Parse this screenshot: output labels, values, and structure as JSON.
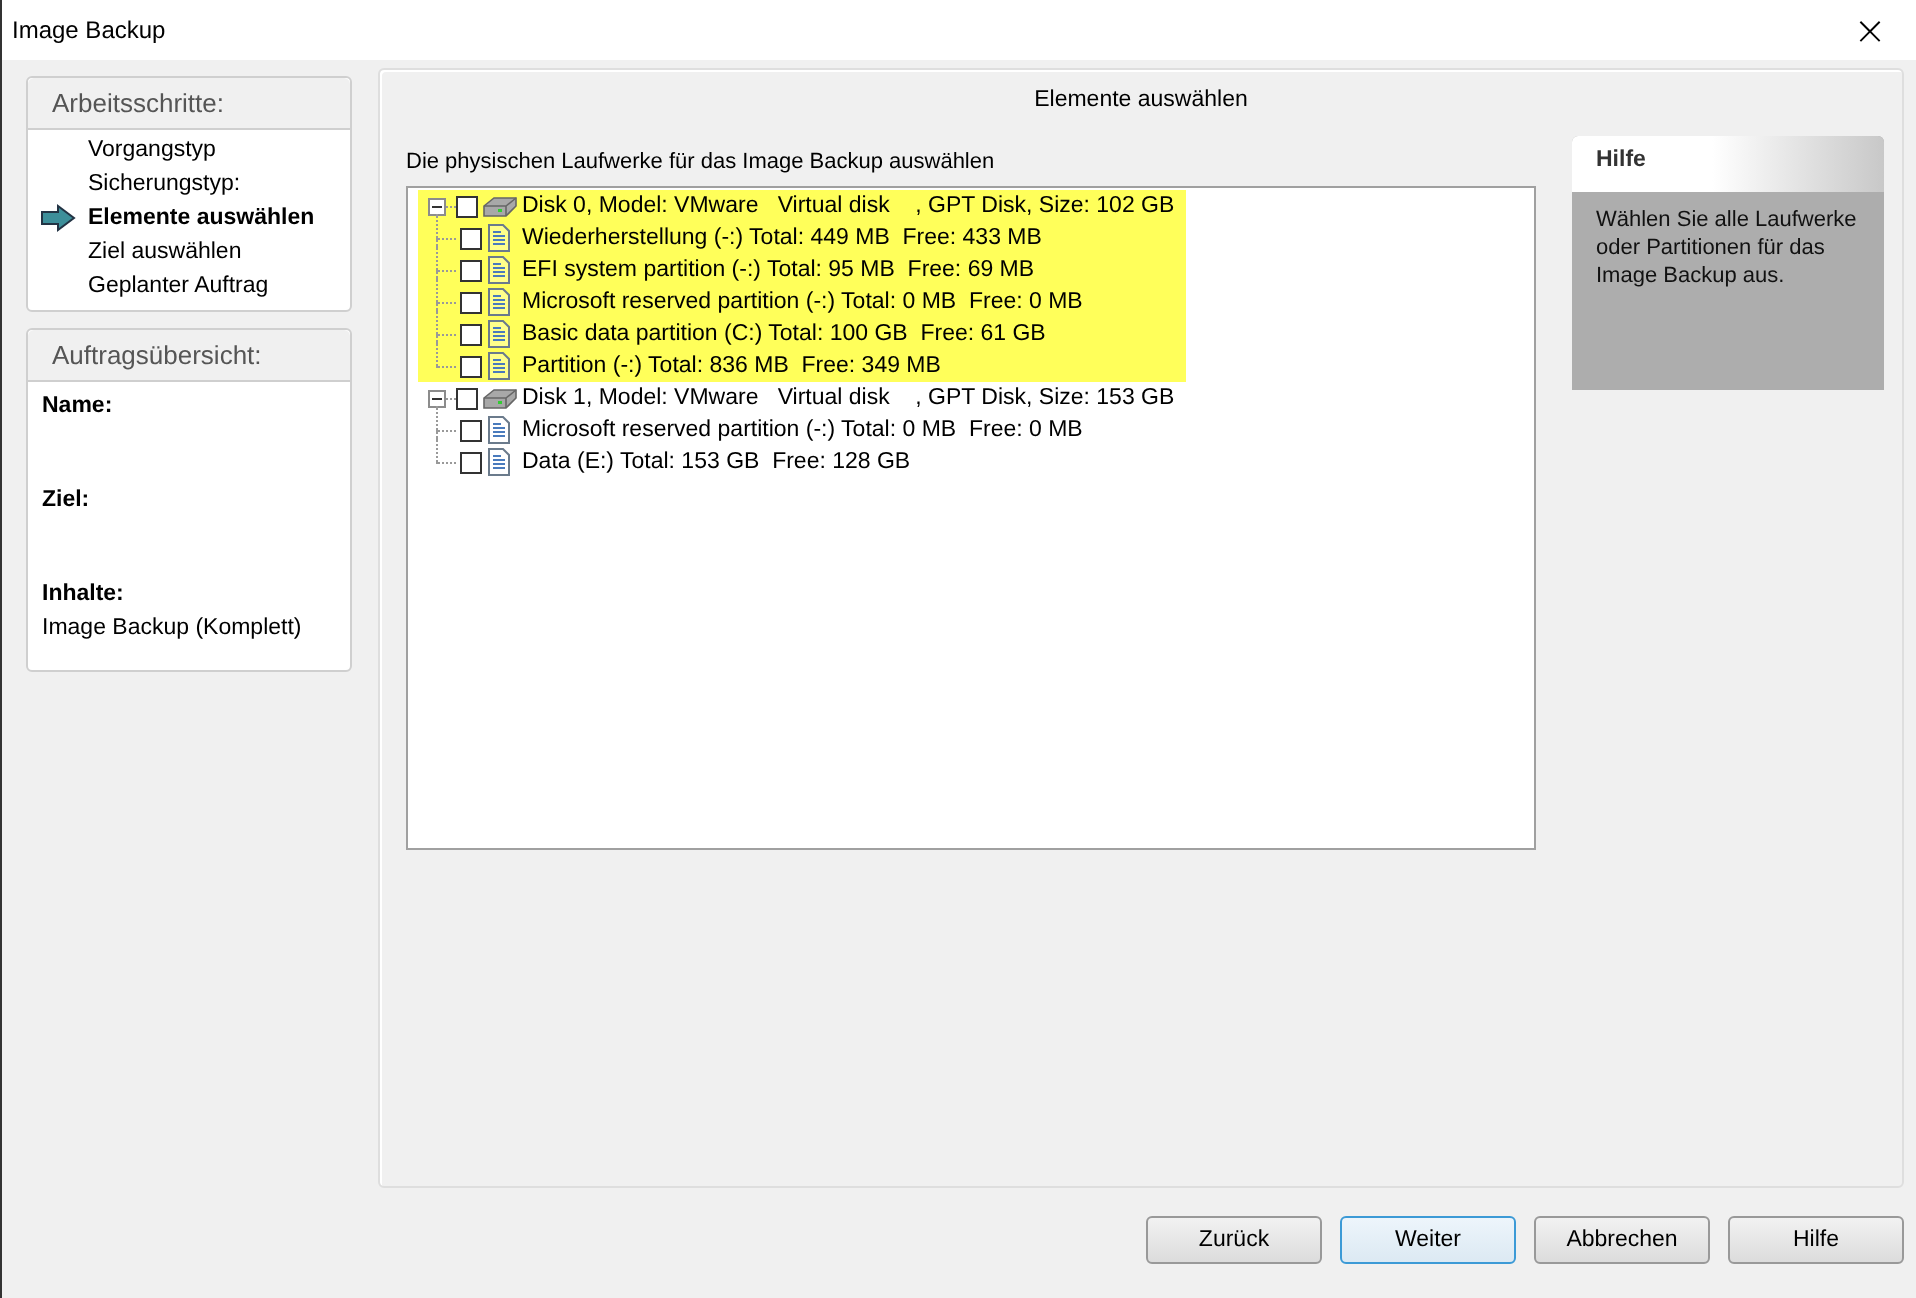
{
  "window": {
    "title": "Image Backup",
    "close": "×"
  },
  "steps": {
    "title": "Arbeitsschritte:",
    "items": [
      {
        "label": "Vorgangstyp",
        "selected": false
      },
      {
        "label": "Sicherungstyp:",
        "selected": false
      },
      {
        "label": "Elemente auswählen",
        "selected": true
      },
      {
        "label": "Ziel auswählen",
        "selected": false
      },
      {
        "label": "Geplanter Auftrag",
        "selected": false
      }
    ]
  },
  "summary": {
    "title": "Auftragsübersicht:",
    "fields": [
      {
        "label": "Name:"
      },
      {
        "label": "Ziel:"
      },
      {
        "label": "Inhalte:",
        "value": "Image Backup (Komplett)"
      }
    ]
  },
  "main": {
    "heading": "Elemente auswählen",
    "subtitle": "Die physischen Laufwerke für das Image Backup auswählen",
    "disks": [
      {
        "label": "Disk 0, Model: VMware   Virtual disk    , GPT Disk, Size: 102 GB",
        "checked": false,
        "expanded": true,
        "highlighted": true,
        "children": [
          {
            "label": "Wiederherstellung (-:) Total: 449 MB  Free: 433 MB",
            "checked": false
          },
          {
            "label": "EFI system partition (-:) Total: 95 MB  Free: 69 MB",
            "checked": false
          },
          {
            "label": "Microsoft reserved partition (-:) Total: 0 MB  Free: 0 MB",
            "checked": false
          },
          {
            "label": "Basic data partition (C:) Total: 100 GB  Free: 61 GB",
            "checked": false
          },
          {
            "label": "Partition (-:) Total: 836 MB  Free: 349 MB",
            "checked": false
          }
        ]
      },
      {
        "label": "Disk 1, Model: VMware   Virtual disk    , GPT Disk, Size: 153 GB",
        "checked": false,
        "expanded": true,
        "highlighted": false,
        "children": [
          {
            "label": "Microsoft reserved partition (-:) Total: 0 MB  Free: 0 MB",
            "checked": false
          },
          {
            "label": "Data (E:) Total: 153 GB  Free: 128 GB",
            "checked": false
          }
        ]
      }
    ]
  },
  "help": {
    "title": "Hilfe",
    "text": "Wählen Sie alle Laufwerke oder Partitionen für das Image Backup aus."
  },
  "buttons": [
    {
      "label": "Zurück",
      "default": false
    },
    {
      "label": "Weiter",
      "default": true
    },
    {
      "label": "Abbrechen",
      "default": false
    },
    {
      "label": "Hilfe",
      "default": false
    }
  ]
}
